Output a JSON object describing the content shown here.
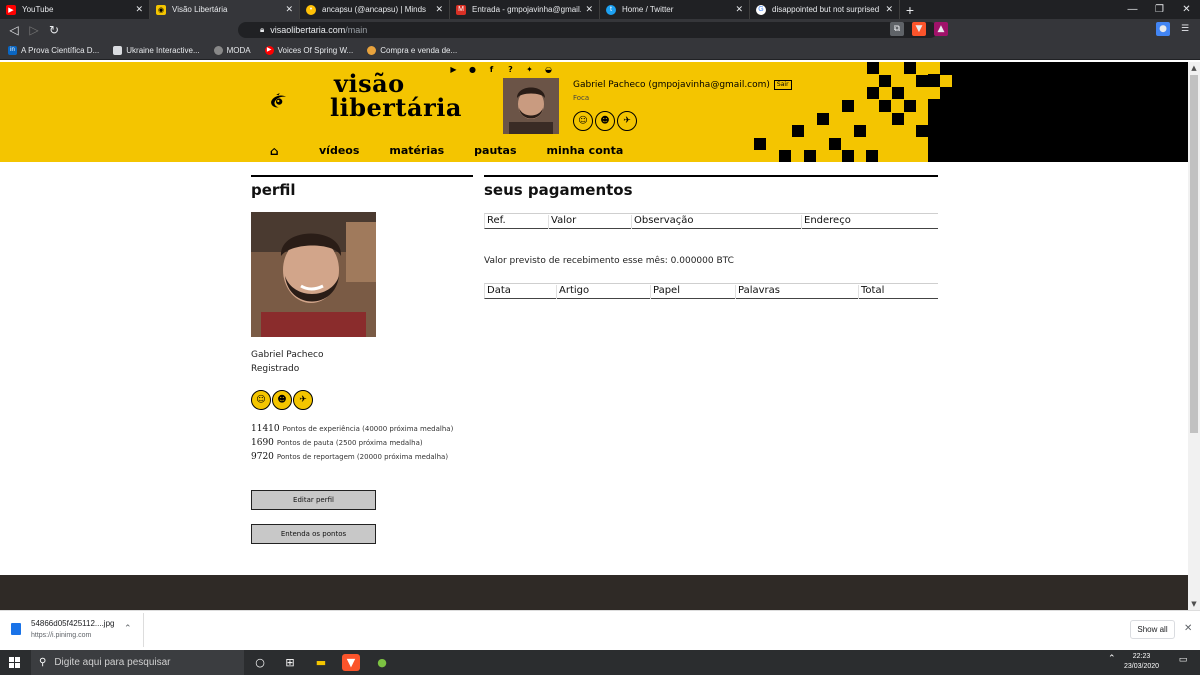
{
  "browser": {
    "tabs": [
      {
        "title": "YouTube",
        "icon": "youtube-icon",
        "color": "#ff0000",
        "active": false
      },
      {
        "title": "Visão Libertária",
        "icon": "visao-libertaria-favicon",
        "color": "#f4c500",
        "active": true
      },
      {
        "title": "ancapsu (@ancapsu) | Minds",
        "icon": "minds-favicon",
        "color": "#ffc107",
        "active": false
      },
      {
        "title": "Entrada - gmpojavinha@gmail.com",
        "icon": "gmail-icon",
        "color": "#d93025",
        "active": false
      },
      {
        "title": "Home / Twitter",
        "icon": "twitter-icon",
        "color": "#1da1f2",
        "active": false
      },
      {
        "title": "disappointed but not surprised lo",
        "icon": "google-icon",
        "color": "#ffffff",
        "active": false
      }
    ],
    "url_host": "visaolibertaria.com",
    "url_path": "/main",
    "bookmarks": [
      {
        "label": "A Prova Científica D...",
        "icon": "linkedin-icon",
        "color": "#0a66c2"
      },
      {
        "label": "Ukraine Interactive...",
        "icon": "page-icon",
        "color": "#9aa0a6"
      },
      {
        "label": "MODA",
        "icon": "moda-icon",
        "color": "#b0b0b0"
      },
      {
        "label": "Voices Of Spring W...",
        "icon": "youtube-icon",
        "color": "#ff0000"
      },
      {
        "label": "Compra e venda de...",
        "icon": "coin-icon",
        "color": "#e8a33d"
      }
    ]
  },
  "site": {
    "brand_line1": "visão",
    "brand_line2": "libertária",
    "brand_color": "#f4c500",
    "social_icons": [
      "youtube-icon",
      "chat-icon",
      "facebook-icon",
      "question-icon",
      "twitter-icon",
      "discord-icon"
    ],
    "user_display": "Gabriel Pacheco (gmpojavinha@gmail.com)",
    "logout_label": "Sair",
    "user_rank": "Foca",
    "nav": [
      "vídeos",
      "matérias",
      "pautas",
      "minha conta"
    ]
  },
  "profile": {
    "heading": "perfil",
    "name": "Gabriel Pacheco",
    "status": "Registrado",
    "stats": [
      {
        "value": "11410",
        "label": "Pontos de experiência (40000 próxima medalha)"
      },
      {
        "value": "1690",
        "label": "Pontos de pauta (2500 próxima medalha)"
      },
      {
        "value": "9720",
        "label": "Pontos de reportagem (20000 próxima medalha)"
      }
    ],
    "edit_button": "Editar perfil",
    "points_button": "Entenda os pontos"
  },
  "payments": {
    "heading": "seus pagamentos",
    "table1_headers": [
      "Ref.",
      "Valor",
      "Observação",
      "Endereço"
    ],
    "expected_text": "Valor previsto de recebimento esse mês: 0.000000 BTC",
    "table2_headers": [
      "Data",
      "Artigo",
      "Papel",
      "Palavras",
      "Total"
    ]
  },
  "downloads": {
    "filename": "54866d05f425112....jpg",
    "source": "https://i.pinimg.com",
    "show_all": "Show all"
  },
  "taskbar": {
    "search_placeholder": "Digite aqui para pesquisar",
    "time": "22:23",
    "date": "23/03/2020"
  }
}
